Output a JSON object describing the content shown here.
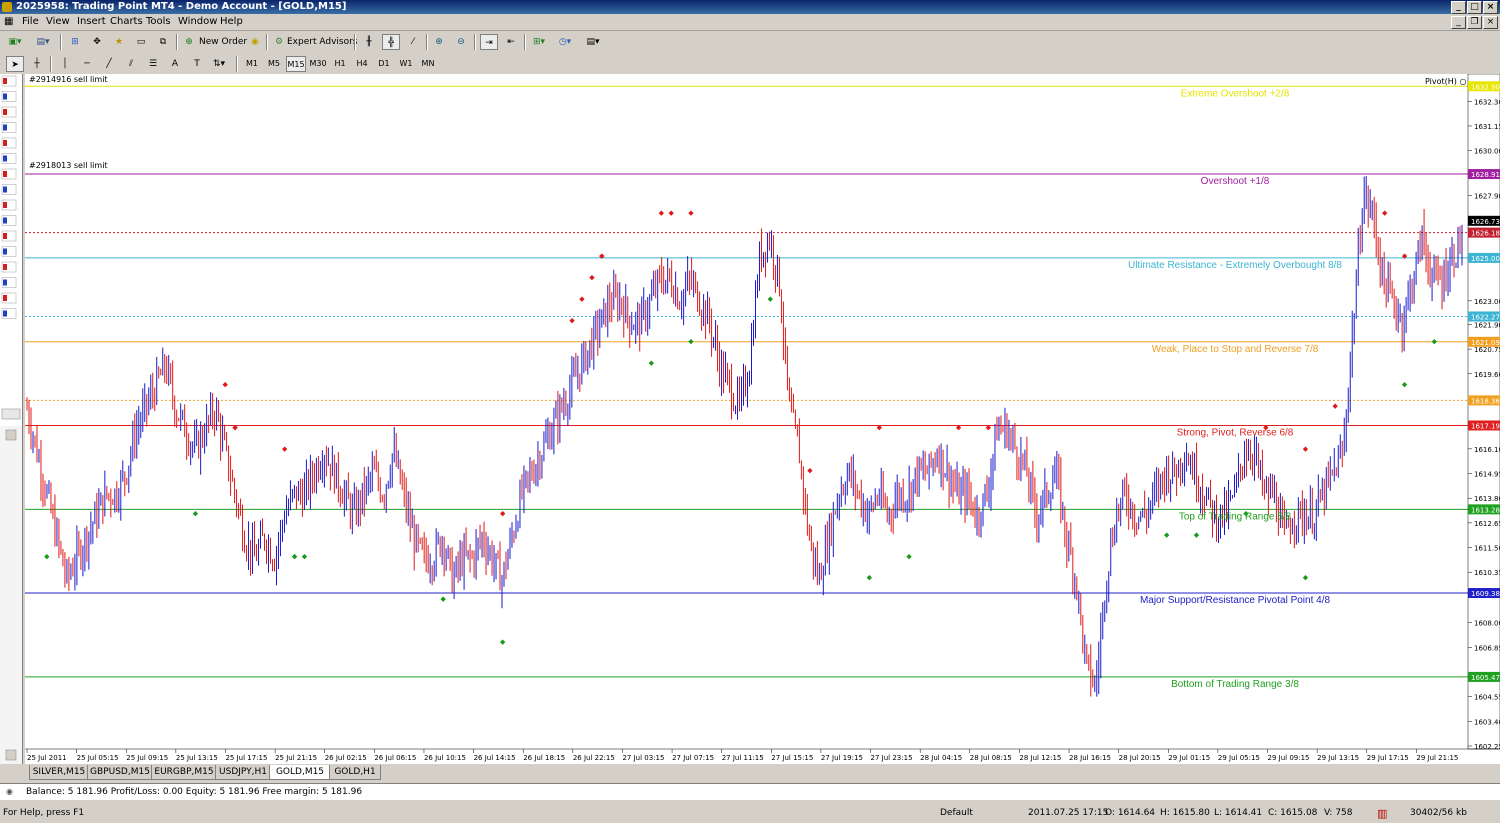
{
  "window": {
    "title": "2025958: Trading Point MT4 - Demo Account - [GOLD,M15]"
  },
  "menu": [
    "File",
    "View",
    "Insert",
    "Charts",
    "Tools",
    "Window",
    "Help"
  ],
  "toolbar": {
    "new_order": "New Order",
    "expert_advisors": "Expert Advisors"
  },
  "timeframes": [
    "M1",
    "M5",
    "M15",
    "M30",
    "H1",
    "H4",
    "D1",
    "W1",
    "MN"
  ],
  "selected_timeframe": "M15",
  "chart": {
    "symbol_corner": "Pivot(H) ○",
    "orders": [
      "#2914916 sell limit",
      "#2918013 sell limit"
    ],
    "price_ticks": [
      "1632.30",
      "1631.15",
      "1630.00",
      "1628.91",
      "1627.90",
      "1626.73",
      "1626.18",
      "1625.00",
      "1623.00",
      "1622.27",
      "1621.90",
      "1620.75",
      "1619.60",
      "1618.36",
      "1617.19",
      "1616.10",
      "1614.95",
      "1613.80",
      "1613.28",
      "1612.65",
      "1611.50",
      "1610.35",
      "1609.38",
      "1608.00",
      "1606.85",
      "1605.47",
      "1604.55",
      "1603.40",
      "1602.25"
    ],
    "time_ticks": [
      "25 Jul 2011",
      "25 Jul 05:15",
      "25 Jul 09:15",
      "25 Jul 13:15",
      "25 Jul 17:15",
      "25 Jul 21:15",
      "26 Jul 02:15",
      "26 Jul 06:15",
      "26 Jul 10:15",
      "26 Jul 14:15",
      "26 Jul 18:15",
      "26 Jul 22:15",
      "27 Jul 03:15",
      "27 Jul 07:15",
      "27 Jul 11:15",
      "27 Jul 15:15",
      "27 Jul 19:15",
      "27 Jul 23:15",
      "28 Jul 04:15",
      "28 Jul 08:15",
      "28 Jul 12:15",
      "28 Jul 16:15",
      "28 Jul 20:15",
      "29 Jul 01:15",
      "29 Jul 05:15",
      "29 Jul 09:15",
      "29 Jul 13:15",
      "29 Jul 17:15",
      "29 Jul 21:15"
    ],
    "levels": [
      {
        "price": 1633.0,
        "label": "Extreme Overshoot  +2/8",
        "color": "#e6e600",
        "tag": "1632.90"
      },
      {
        "price": 1628.91,
        "label": "Overshoot  +1/8",
        "color": "#a020a0",
        "tag": "1628.91"
      },
      {
        "price": 1625.0,
        "label": "Ultimate Resistance - Extremely Overbought  8/8",
        "color": "#3cb4d2",
        "tag": "1625.00"
      },
      {
        "price": 1621.09,
        "label": "Weak, Place to Stop and Reverse  7/8",
        "color": "#f0a020",
        "tag": "1621.09"
      },
      {
        "price": 1617.19,
        "label": "Strong, Pivot, Reverse  6/8",
        "color": "#e02020",
        "tag": "1617.19"
      },
      {
        "price": 1613.28,
        "label": "Top of Trading Range  5/8",
        "color": "#20a020",
        "tag": "1613.28"
      },
      {
        "price": 1609.38,
        "label": "Major Support/Resistance Pivotal Point  4/8",
        "color": "#2020c8",
        "tag": "1609.38"
      },
      {
        "price": 1605.47,
        "label": "Bottom of Trading Range  3/8",
        "color": "#20a020",
        "tag": "1605.47"
      }
    ],
    "dashed_levels": [
      {
        "price": 1626.18,
        "color": "#c02030",
        "tag": "1626.18"
      },
      {
        "price": 1622.27,
        "color": "#3cb4d2",
        "tag": "1622.27"
      },
      {
        "price": 1618.36,
        "color": "#f0a020",
        "tag": "1618.36"
      }
    ],
    "last_price": "1626.73",
    "close_series": [
      1618,
      1616,
      1614,
      1612,
      1610,
      1611,
      1612,
      1613,
      1614,
      1614,
      1615,
      1617,
      1618,
      1619,
      1620,
      1618,
      1617,
      1616,
      1617,
      1618,
      1616,
      1614,
      1612,
      1611,
      1612,
      1611,
      1613,
      1614,
      1614,
      1615,
      1616,
      1615,
      1614,
      1613,
      1614,
      1615,
      1614,
      1616,
      1614,
      1612,
      1611,
      1611,
      1612,
      1610,
      1611,
      1611,
      1612,
      1611,
      1610,
      1612,
      1614,
      1615,
      1616,
      1617,
      1618,
      1619,
      1620,
      1621,
      1622,
      1623,
      1623,
      1622,
      1622,
      1623,
      1624,
      1624,
      1623,
      1624,
      1623,
      1622,
      1620,
      1619,
      1618,
      1620,
      1625,
      1626,
      1624,
      1618,
      1616,
      1612,
      1610,
      1612,
      1614,
      1615,
      1614,
      1613,
      1614,
      1613,
      1614,
      1614,
      1615,
      1615,
      1616,
      1615,
      1614,
      1614,
      1613,
      1614,
      1617,
      1617,
      1616,
      1615,
      1613,
      1614,
      1615,
      1612,
      1610,
      1606,
      1605,
      1610,
      1613,
      1614,
      1613,
      1613,
      1614,
      1615,
      1615,
      1616,
      1615,
      1614,
      1613,
      1613,
      1614,
      1616,
      1616,
      1614,
      1614,
      1612,
      1613,
      1613,
      1613,
      1614,
      1615,
      1616,
      1622,
      1628,
      1627,
      1624,
      1623,
      1622,
      1624,
      1626,
      1624,
      1624,
      1625,
      1626
    ]
  },
  "tabs": [
    "SILVER,M15",
    "GBPUSD,M15",
    "EURGBP,M15",
    "USDJPY,H1",
    "GOLD,M15",
    "GOLD,H1"
  ],
  "active_tab": "GOLD,M15",
  "terminal": {
    "balance": "Balance: 5 181.96  Profit/Loss: 0.00  Equity: 5 181.96  Free margin: 5 181.96"
  },
  "status": {
    "help": "For Help, press F1",
    "profile": "Default",
    "datetime": "2011.07.25 17:15",
    "open": "O: 1614.64",
    "high": "H: 1615.80",
    "low": "L: 1614.41",
    "close": "C: 1615.08",
    "volume": "V: 758",
    "traffic": "30402/56 kb"
  }
}
